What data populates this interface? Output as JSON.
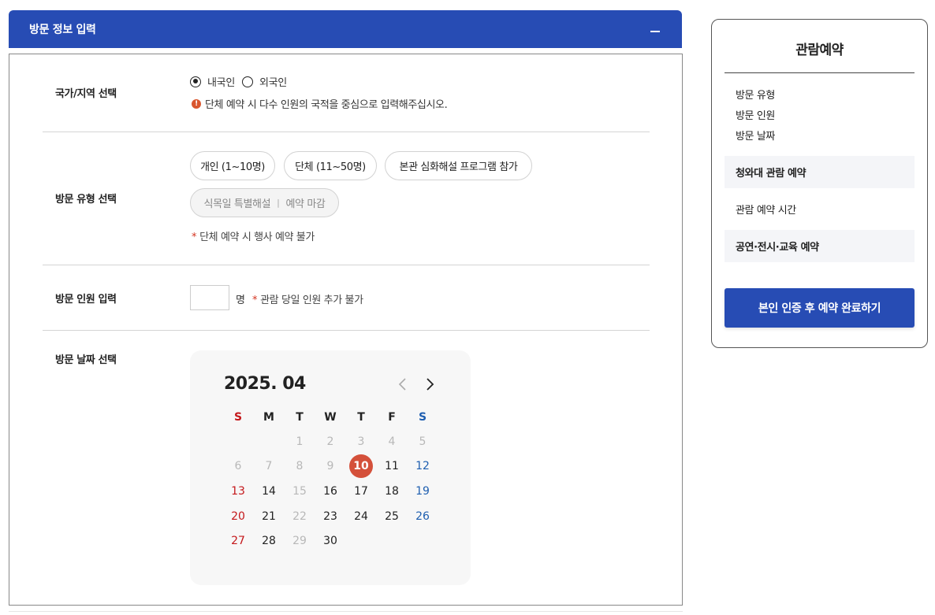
{
  "panel": {
    "title": "방문 정보 입력",
    "collapse_label": "—"
  },
  "nationality": {
    "label": "국가/지역 선택",
    "options": [
      {
        "label": "내국인",
        "checked": true
      },
      {
        "label": "외국인",
        "checked": false
      }
    ],
    "notice": "단체 예약 시 다수 인원의 국적을 중심으로 입력해주십시오."
  },
  "visit_type": {
    "label": "방문 유형 선택",
    "chips": [
      {
        "label": "개인 (1~10명)"
      },
      {
        "label": "단체 (11~50명)"
      },
      {
        "label": "본관 심화해설 프로그램 참가"
      }
    ],
    "disabled_chip": {
      "label": "식목일 특별해설",
      "status": "예약 마감"
    },
    "note": "단체 예약 시 행사 예약 불가"
  },
  "visitors": {
    "label": "방문 인원 입력",
    "value": "",
    "unit": "명",
    "note": "관람 당일 인원 추가 불가"
  },
  "visit_date": {
    "label": "방문 날짜 선택",
    "calendar": {
      "title": "2025. 04",
      "weekdays": [
        "S",
        "M",
        "T",
        "W",
        "T",
        "F",
        "S"
      ],
      "first_weekday_index": 2,
      "days_in_month": 30,
      "today": 10,
      "past_days": [
        1,
        2,
        3,
        4,
        5,
        6,
        7,
        8,
        9,
        15,
        22,
        29
      ],
      "colors": {
        "sunday": "#c4181b",
        "saturday": "#1f5fb0",
        "today": "#d4503a"
      }
    }
  },
  "sidebar": {
    "title": "관람예약",
    "summary_items": [
      "방문 유형",
      "방문 인원",
      "방문 날짜"
    ],
    "sections": [
      "청와대 관람 예약",
      "관람 예약 시간",
      "공연·전시·교육 예약"
    ],
    "submit_label": "본인 인증 후 예약 완료하기"
  },
  "colors": {
    "brand": "#274cb4",
    "accent": "#d4503a"
  }
}
